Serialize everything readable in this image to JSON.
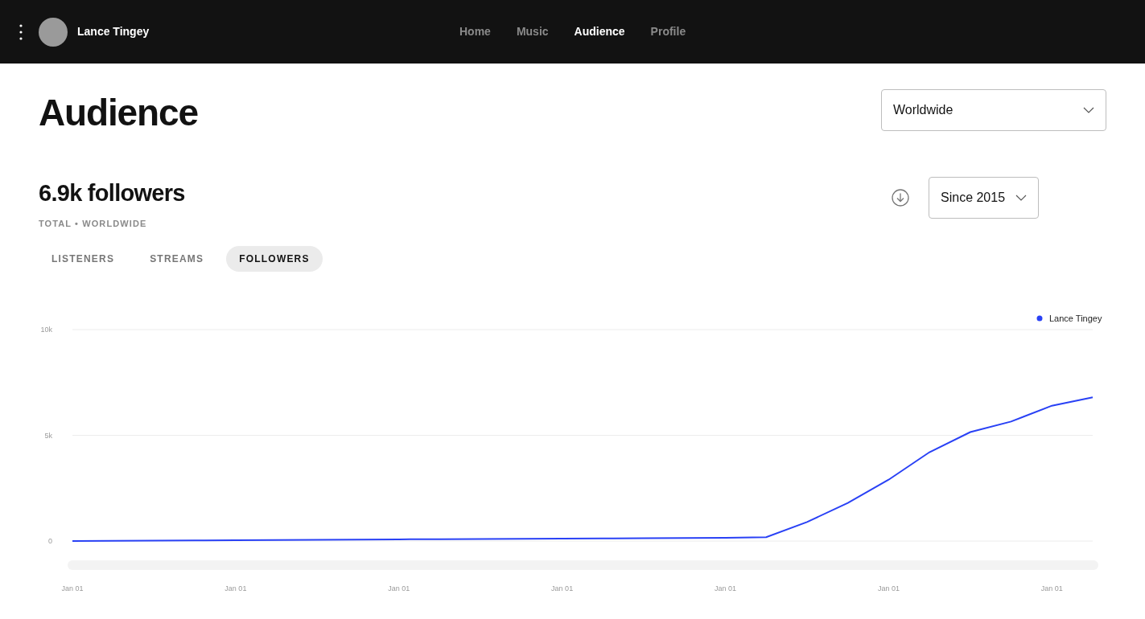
{
  "header": {
    "user_name": "Lance Tingey",
    "nav": [
      {
        "label": "Home",
        "selected": false
      },
      {
        "label": "Music",
        "selected": false
      },
      {
        "label": "Audience",
        "selected": true
      },
      {
        "label": "Profile",
        "selected": false
      }
    ]
  },
  "page_title": "Audience",
  "region_select": {
    "value": "Worldwide"
  },
  "summary": {
    "headline": "6.9k followers",
    "subtitle": "TOTAL • WORLDWIDE"
  },
  "period_select": {
    "value": "Since 2015"
  },
  "metric_tabs": [
    {
      "label": "LISTENERS",
      "selected": false
    },
    {
      "label": "STREAMS",
      "selected": false
    },
    {
      "label": "FOLLOWERS",
      "selected": true
    }
  ],
  "chart_data": {
    "type": "line",
    "categories": [
      "Jan 01",
      null,
      null,
      null,
      "Jan 01",
      null,
      null,
      null,
      "Jan 01",
      null,
      null,
      null,
      "Jan 01",
      null,
      null,
      null,
      "Jan 01",
      null,
      null,
      null,
      "Jan 01",
      null,
      null,
      null,
      "Jan 01",
      null
    ],
    "series": [
      {
        "name": "Lance Tingey",
        "color": "#2941f5",
        "values": [
          0,
          10,
          20,
          30,
          40,
          50,
          60,
          70,
          80,
          88,
          95,
          103,
          110,
          120,
          130,
          140,
          150,
          180,
          900,
          1800,
          2900,
          4200,
          5150,
          5650,
          6400,
          6800
        ]
      }
    ],
    "ylim": [
      0,
      10000
    ],
    "yticks": [
      {
        "value": 0,
        "label": "0"
      },
      {
        "value": 5000,
        "label": "5k"
      },
      {
        "value": 10000,
        "label": "10k"
      }
    ]
  }
}
